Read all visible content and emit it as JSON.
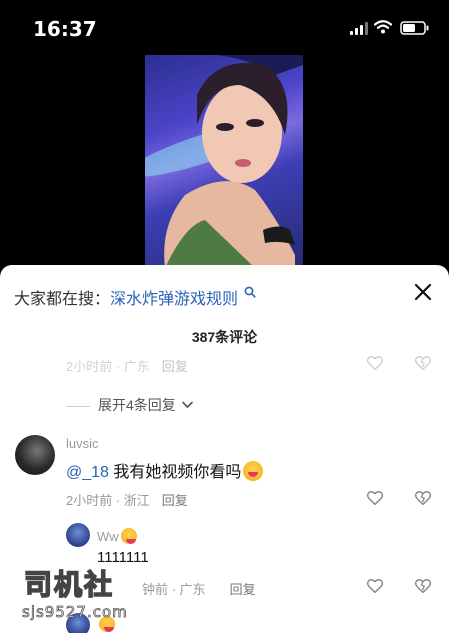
{
  "status_bar": {
    "time": "16:37"
  },
  "search": {
    "prefix": "大家都在搜：",
    "term": "深水炸弹游戏规则"
  },
  "comments": {
    "count_label": "387条评论",
    "prev": {
      "meta": "2小时前 · 广东",
      "reply": "回复"
    },
    "expand_label": "展开4条回复",
    "main": {
      "username": "luvsic",
      "mention": "@_18",
      "text": " 我有她视频你看吗",
      "meta": "2小时前 · 浙江",
      "reply": "回复"
    },
    "reply1": {
      "username": "Ww",
      "text": "1111111",
      "meta": "钟前 · 广东",
      "reply": "回复"
    }
  },
  "watermark": {
    "logo": "司机社",
    "url": "sjs9527.com"
  }
}
